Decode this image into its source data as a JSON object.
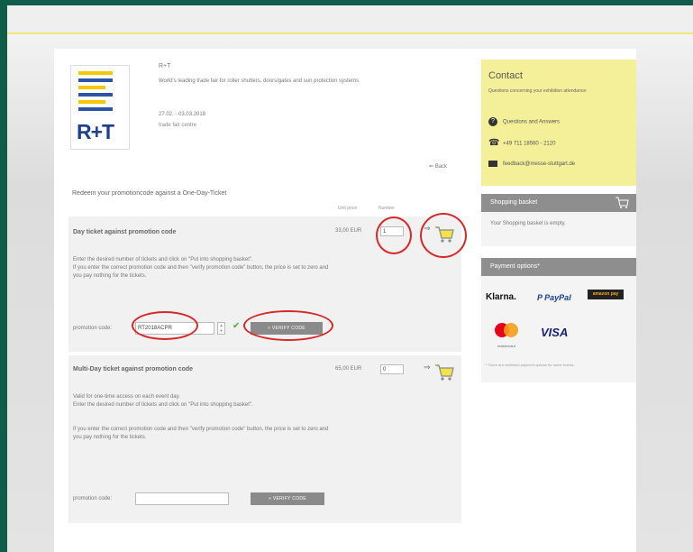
{
  "header": {
    "fair_name": "R+T",
    "fair_description": "World's leading trade fair for roller shutters, doors/gates and sun protection systems",
    "fair_dates": "27.02. - 03.03.2018",
    "fair_location": "trade fair centre",
    "back_label": "Back",
    "logo_text": "R+T"
  },
  "main": {
    "intro": "Redeem your promotioncode against a One-Day-Ticket",
    "col_unit_price": "Unit price",
    "col_number": "Number",
    "products": [
      {
        "title": "Day ticket against promotion code",
        "text": "Enter the desired number of tickets and click on \"Put into shopping basket\".\nIf you enter the correct promotion code and then \"verify promotion code\" button, the price is set to zero and you pay nothing for the tickets.",
        "price": "33,00 EUR",
        "quantity": "1",
        "promo_label": "promotion code:",
        "promo_value": "RT2018ACPR",
        "verify_label": "» VERIFY CODE"
      },
      {
        "title": "Multi-Day ticket against promotion code",
        "text": "Valid for one-time access on each event day.\nEnter the desired number of tickets and click on \"Put into shopping basket\".\n\n\nIf you enter the correct promotion code and then \"verify promotion code\" button, the price is set to zero and you pay nothing for the tickets.",
        "price": "65,00 EUR",
        "quantity": "0",
        "promo_label": "promotion code:",
        "promo_value": "",
        "verify_label": "» VERIFY CODE"
      }
    ]
  },
  "sidebar": {
    "contact_title": "Contact",
    "contact_sub": "Questions concerning your exhibition attendance:",
    "contact_rows": [
      {
        "icon": "question-icon",
        "text": "Questions and Answers"
      },
      {
        "icon": "phone-icon",
        "text": "+49 711 18560 - 2120"
      },
      {
        "icon": "mail-icon",
        "text": "feedback@messe-stuttgart.de"
      }
    ],
    "basket_title": "Shopping basket",
    "basket_empty": "Your Shopping basket is empty.",
    "payment_title": "Payment options*",
    "payment_logos": {
      "klarna": "Klarna.",
      "paypal": "P PayPal",
      "amazon": "amazon pay",
      "mastercard": "mastercard",
      "visa": "VISA"
    },
    "payment_footnote": "* There are restricted payment options for some events."
  },
  "colors": {
    "accent_yellow": "#f4f09a",
    "border_green": "#0f5c48",
    "highlight_red": "#d42a2a",
    "panel_grey": "#8e8e8e"
  }
}
